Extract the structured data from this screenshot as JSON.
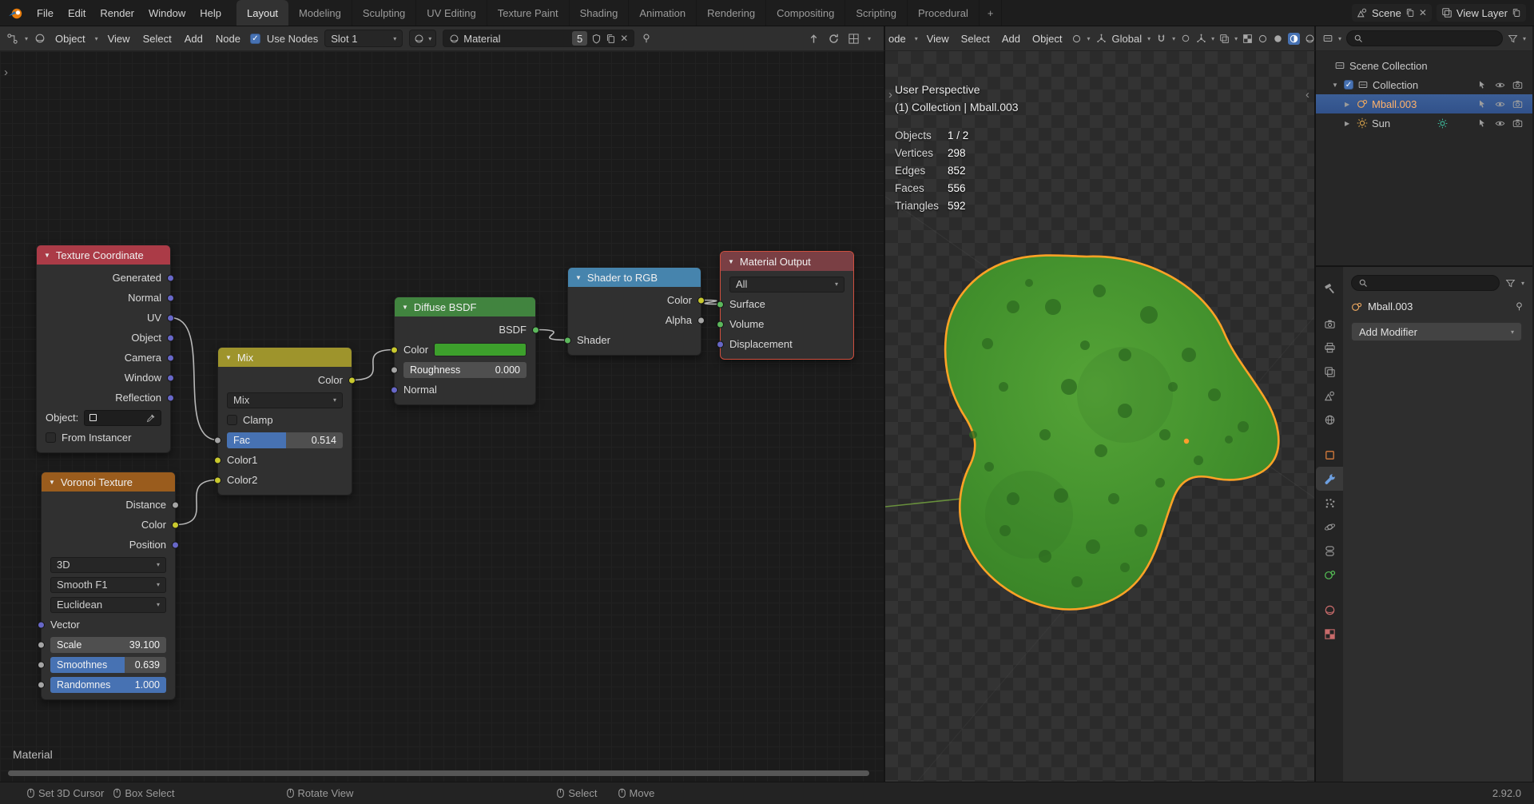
{
  "topbar": {
    "menus": [
      "File",
      "Edit",
      "Render",
      "Window",
      "Help"
    ],
    "tabs": [
      {
        "label": "Layout",
        "active": true
      },
      {
        "label": "Modeling"
      },
      {
        "label": "Sculpting"
      },
      {
        "label": "UV Editing"
      },
      {
        "label": "Texture Paint"
      },
      {
        "label": "Shading"
      },
      {
        "label": "Animation"
      },
      {
        "label": "Rendering"
      },
      {
        "label": "Compositing"
      },
      {
        "label": "Scripting"
      },
      {
        "label": "Procedural"
      }
    ],
    "add_tab": "+",
    "scene_label": "Scene",
    "view_layer_label": "View Layer"
  },
  "shader_header": {
    "object_type": "Object",
    "menus": [
      "View",
      "Select",
      "Add",
      "Node"
    ],
    "use_nodes": "Use Nodes",
    "slot": "Slot 1",
    "material_name": "Material",
    "users_count": "5"
  },
  "viewport_header": {
    "mode": "ode",
    "menus": [
      "View",
      "Select",
      "Add",
      "Object"
    ],
    "orientation": "Global"
  },
  "viewport": {
    "overlay": {
      "perspective": "User Perspective",
      "context": "(1) Collection | Mball.003"
    },
    "stats": [
      {
        "label": "Objects",
        "value": "1 / 2"
      },
      {
        "label": "Vertices",
        "value": "298"
      },
      {
        "label": "Edges",
        "value": "852"
      },
      {
        "label": "Faces",
        "value": "556"
      },
      {
        "label": "Triangles",
        "value": "592"
      }
    ]
  },
  "outliner": {
    "rows": [
      {
        "label": "Scene Collection"
      },
      {
        "label": "Collection"
      },
      {
        "label": "Mball.003",
        "selected": true
      },
      {
        "label": "Sun"
      }
    ]
  },
  "properties": {
    "breadcrumb": "Mball.003",
    "add_modifier": "Add Modifier"
  },
  "nodes": {
    "texture_coordinate": {
      "title": "Texture Coordinate",
      "header_color": "#ab3b47",
      "outputs": [
        "Generated",
        "Normal",
        "UV",
        "Object",
        "Camera",
        "Window",
        "Reflection"
      ],
      "object_label": "Object:",
      "from_instancer": "From Instancer"
    },
    "voronoi": {
      "title": "Voronoi Texture",
      "header_color": "#9a5c1d",
      "outputs": [
        "Distance",
        "Color",
        "Position"
      ],
      "dimensions": "3D",
      "feature": "Smooth F1",
      "distance_metric": "Euclidean",
      "vector_label": "Vector",
      "scale_label": "Scale",
      "scale_value": "39.100",
      "smoothness_label": "Smoothnes",
      "smoothness_value": "0.639",
      "smoothness_pct": 64,
      "randomness_label": "Randomnes",
      "randomness_value": "1.000",
      "randomness_pct": 100
    },
    "mix": {
      "title": "Mix",
      "header_color": "#9e942c",
      "output": "Color",
      "blend_mode": "Mix",
      "clamp_label": "Clamp",
      "fac_label": "Fac",
      "fac_value": "0.514",
      "fac_pct": 51,
      "color1_label": "Color1",
      "color2_label": "Color2"
    },
    "diffuse": {
      "title": "Diffuse BSDF",
      "header_color": "#41843f",
      "output": "BSDF",
      "color_label": "Color",
      "color_swatch": "#3da02c",
      "roughness_label": "Roughness",
      "roughness_value": "0.000",
      "roughness_pct": 0,
      "normal_label": "Normal"
    },
    "shader_to_rgb": {
      "title": "Shader to RGB",
      "header_color": "#4684ad",
      "outputs": [
        "Color",
        "Alpha"
      ],
      "input": "Shader"
    },
    "material_output": {
      "title": "Material Output",
      "header_color": "#7a3f44",
      "target": "All",
      "inputs": [
        "Surface",
        "Volume",
        "Displacement"
      ]
    }
  },
  "node_editor": {
    "tree_label": "Material"
  },
  "wires": [
    {
      "from": "tc-uv",
      "to": "mix-fac"
    },
    {
      "from": "vor-color",
      "to": "mix-color2"
    },
    {
      "from": "mix-color",
      "to": "dif-color"
    },
    {
      "from": "dif-bsdf",
      "to": "srgb-shader"
    },
    {
      "from": "srgb-color",
      "to": "out-surface"
    }
  ],
  "colors": {
    "slider_fill": "#4772b3",
    "slider_track": "#4f4f4f",
    "wire": "#b8b8b8",
    "accent": "#4772b3",
    "selection_row": "#35568f",
    "object_outline": "#ffa226",
    "metaball_fill": "#3f8f2b"
  },
  "statusbar": {
    "items": [
      "Set 3D Cursor",
      "Box Select",
      "Rotate View",
      "Select",
      "Move"
    ],
    "version": "2.92.0"
  }
}
